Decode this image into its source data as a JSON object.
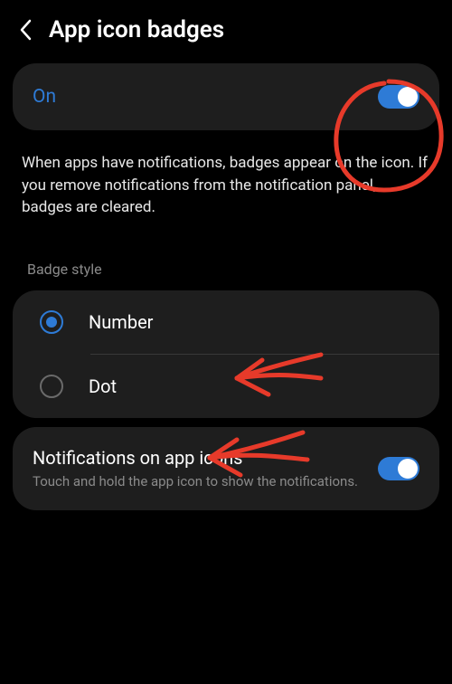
{
  "header": {
    "title": "App icon badges"
  },
  "main_toggle": {
    "label": "On",
    "state": true
  },
  "description": "When apps have notifications, badges appear on the icon. If you remove notifications from the notification panel, badges are cleared.",
  "badge_style": {
    "section_label": "Badge style",
    "options": [
      {
        "label": "Number",
        "selected": true
      },
      {
        "label": "Dot",
        "selected": false
      }
    ]
  },
  "notifications_on_icons": {
    "title": "Notifications on app icons",
    "subtitle": "Touch and hold the app icon to show the notifications.",
    "state": true
  },
  "colors": {
    "accent": "#2e7bd6",
    "annotation": "#e73a2a"
  }
}
